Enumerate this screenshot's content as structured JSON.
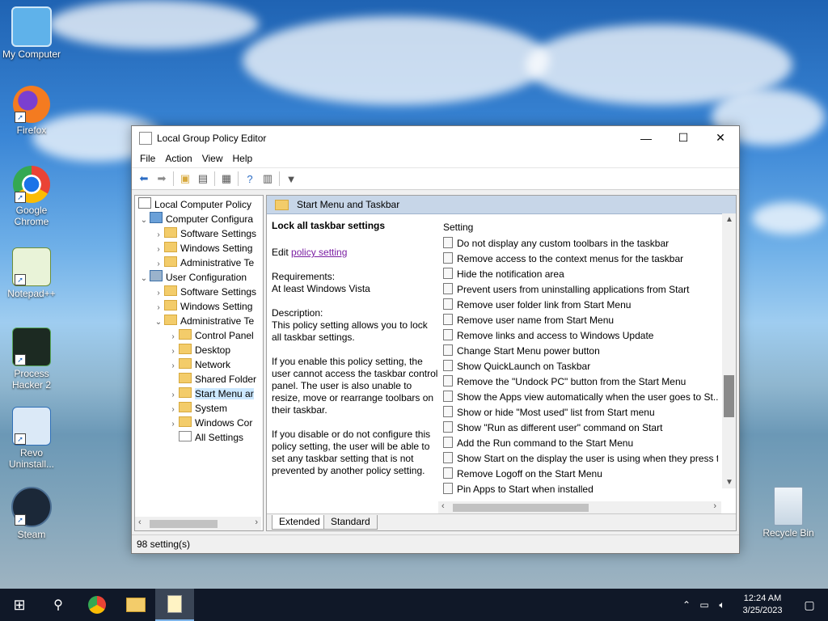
{
  "desktop": {
    "icons": [
      {
        "label": "My Computer"
      },
      {
        "label": "Firefox"
      },
      {
        "label": "Google Chrome"
      },
      {
        "label": "Notepad++"
      },
      {
        "label": "Process Hacker 2"
      },
      {
        "label": "Revo Uninstall..."
      },
      {
        "label": "Steam"
      },
      {
        "label": "Recycle Bin"
      }
    ]
  },
  "window": {
    "title": "Local Group Policy Editor",
    "controls": {
      "minimize": "—",
      "maximize": "☐",
      "close": "✕"
    },
    "menu": [
      "File",
      "Action",
      "View",
      "Help"
    ],
    "tree": [
      {
        "label": "Local Computer Policy"
      },
      {
        "label": "Computer Configura"
      },
      {
        "label": "Software Settings"
      },
      {
        "label": "Windows Setting"
      },
      {
        "label": "Administrative Te"
      },
      {
        "label": "User Configuration"
      },
      {
        "label": "Software Settings"
      },
      {
        "label": "Windows Setting"
      },
      {
        "label": "Administrative Te"
      },
      {
        "label": "Control Panel"
      },
      {
        "label": "Desktop"
      },
      {
        "label": "Network"
      },
      {
        "label": "Shared Folder"
      },
      {
        "label": "Start Menu ar"
      },
      {
        "label": "System"
      },
      {
        "label": "Windows Cor"
      },
      {
        "label": "All Settings"
      }
    ],
    "section_title": "Start Menu and Taskbar",
    "description": {
      "heading": "Lock all taskbar settings",
      "edit_prefix": "Edit ",
      "edit_link": "policy setting ",
      "requirements_label": "Requirements:",
      "requirements_value": "At least Windows Vista",
      "description_label": "Description:",
      "p1": "This policy setting allows you to lock all taskbar settings.",
      "p2": "If you enable this policy setting, the user cannot access the taskbar control panel. The user is also unable to resize, move or rearrange toolbars on their taskbar.",
      "p3": "If you disable or do not configure this policy setting, the user will be able to set any taskbar setting that is not prevented by another policy setting."
    },
    "list_header": "Setting",
    "settings": [
      "Do not display any custom toolbars in the taskbar",
      "Remove access to the context menus for the taskbar",
      "Hide the notification area",
      "Prevent users from uninstalling applications from Start",
      "Remove user folder link from Start Menu",
      "Remove user name from Start Menu",
      "Remove links and access to Windows Update",
      "Change Start Menu power button",
      "Show QuickLaunch on Taskbar",
      "Remove the \"Undock PC\" button from the Start Menu",
      "Show the Apps view automatically when the user goes to St...",
      "Show or hide \"Most used\" list from Start menu",
      "Show \"Run as different user\" command on Start",
      "Add the Run command to the Start Menu",
      "Show Start on the display the user is using when they press t...",
      "Remove Logoff on the Start Menu",
      "Pin Apps to Start when installed"
    ],
    "tabs": [
      "Extended",
      "Standard"
    ],
    "status": "98 setting(s)"
  },
  "taskbar": {
    "time": "12:24 AM",
    "date": "3/25/2023"
  }
}
